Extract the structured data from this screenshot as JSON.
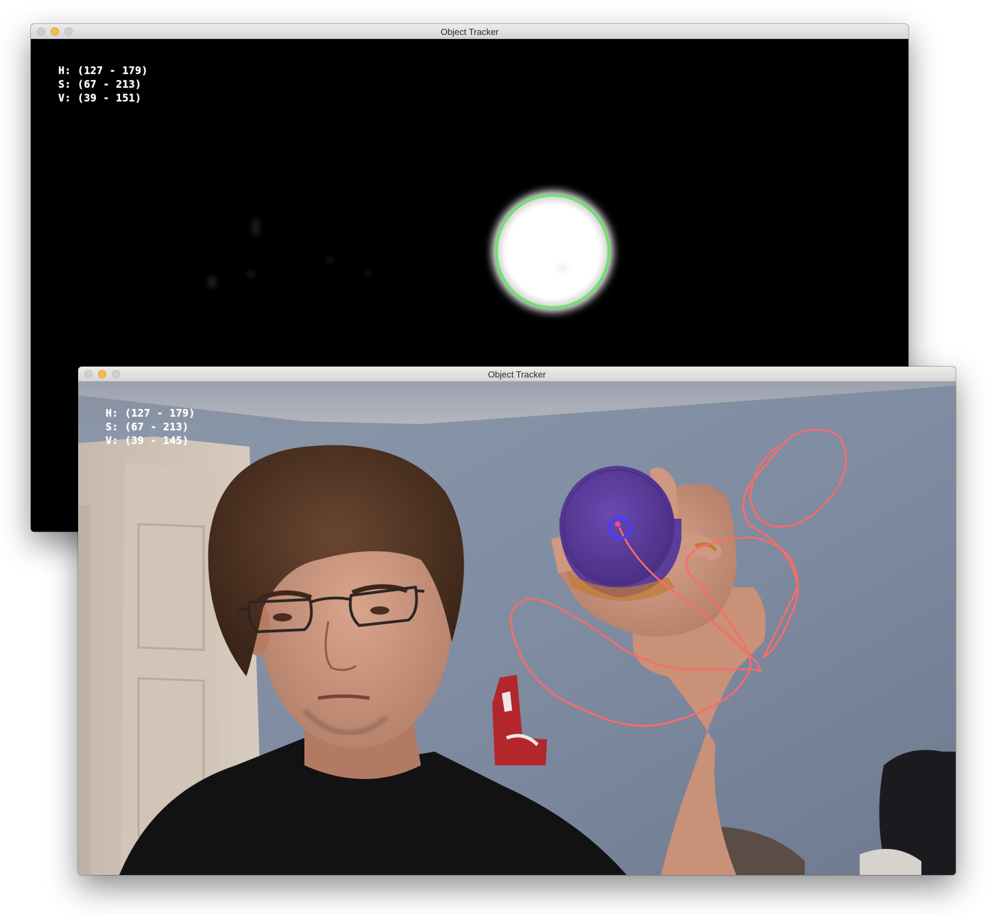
{
  "windows": [
    {
      "id": "mask",
      "title": "Object Tracker",
      "hsv": {
        "h_label": "H:",
        "h_range": "(127 - 179)",
        "s_label": "S:",
        "s_range": "(67 - 213)",
        "v_label": "V:",
        "v_range": "(39 - 151)"
      },
      "tracker_circle_color": "#6fe06f",
      "background_color": "#000000"
    },
    {
      "id": "camera",
      "title": "Object Tracker",
      "hsv": {
        "h_label": "H:",
        "h_range": "(127 - 179)",
        "s_label": "S:",
        "s_range": "(67 - 213)",
        "v_label": "V:",
        "v_range": "(39 - 145)"
      },
      "trail_color": "#ff6a6a",
      "tracker_circle_color": "#4a3cff",
      "object_color": "#5b3d9a"
    }
  ]
}
